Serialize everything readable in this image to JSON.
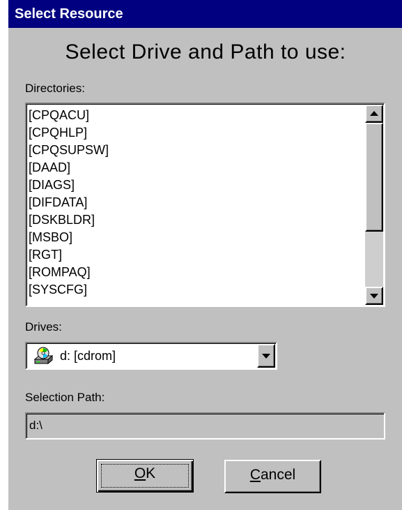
{
  "window": {
    "title": "Select Resource"
  },
  "heading": "Select Drive and Path to use:",
  "directories": {
    "label": "Directories:",
    "items": [
      "[CPQACU]",
      "[CPQHLP]",
      "[CPQSUPSW]",
      "[DAAD]",
      "[DIAGS]",
      "[DIFDATA]",
      "[DSKBLDR]",
      "[MSBO]",
      "[RGT]",
      "[ROMPAQ]",
      "[SYSCFG]"
    ],
    "scroll_up_icon": "scroll-up-arrow",
    "scroll_down_icon": "scroll-down-arrow"
  },
  "drives": {
    "label": "Drives:",
    "selected": "d: [cdrom]",
    "icon": "cdrom-drive-icon"
  },
  "selection_path": {
    "label": "Selection Path:",
    "value": "d:\\"
  },
  "buttons": {
    "ok_mnemonic": "O",
    "ok_rest": "K",
    "cancel_mnemonic": "C",
    "cancel_rest": "ancel"
  },
  "colors": {
    "titlebar": "#000080",
    "face": "#c0c0c0"
  }
}
